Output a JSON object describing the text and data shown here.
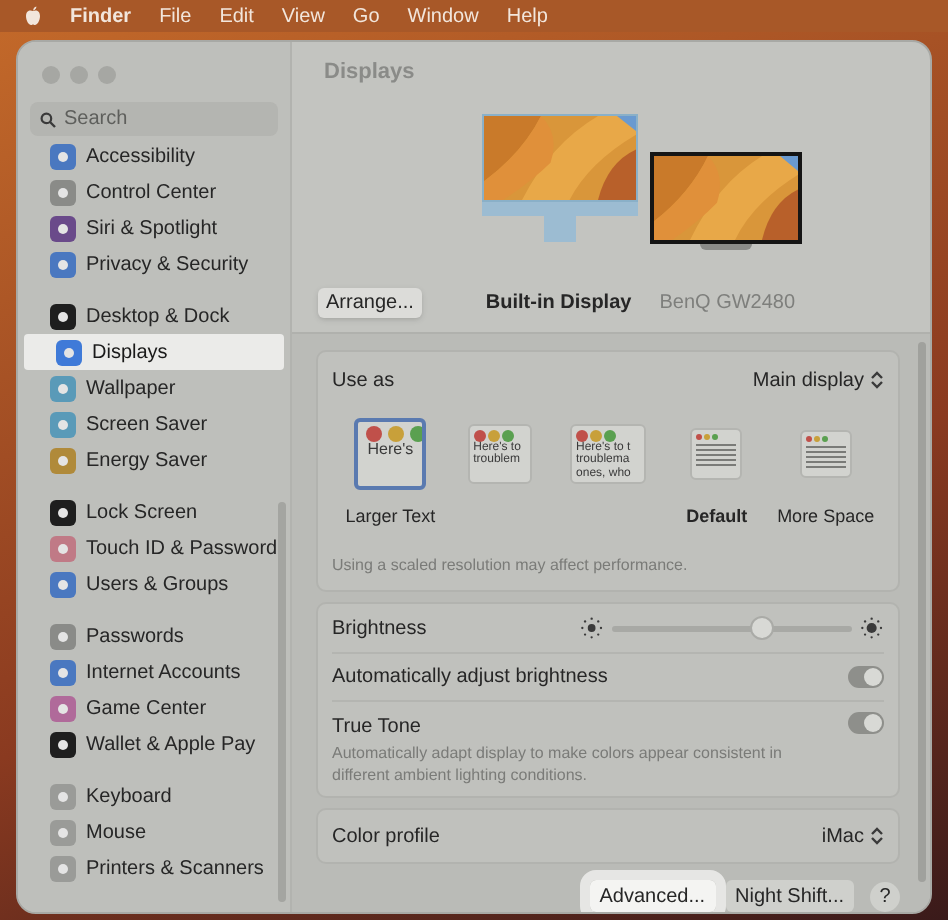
{
  "menu_bar": {
    "app": "Finder",
    "items": [
      "File",
      "Edit",
      "View",
      "Go",
      "Window",
      "Help"
    ]
  },
  "sidebar": {
    "search": {
      "placeholder": "Search"
    },
    "groups": [
      [
        {
          "label": "Accessibility",
          "color": "#4a78c0",
          "selected": false
        },
        {
          "label": "Control Center",
          "color": "#8a8b88",
          "selected": false
        },
        {
          "label": "Siri & Spotlight",
          "color": "#6a4a8a",
          "selected": false
        },
        {
          "label": "Privacy & Security",
          "color": "#4a78c0",
          "selected": false
        }
      ],
      [
        {
          "label": "Desktop & Dock",
          "color": "#1e1e1e",
          "selected": false
        },
        {
          "label": "Displays",
          "color": "#3f7ad8",
          "selected": true
        },
        {
          "label": "Wallpaper",
          "color": "#5a9ab8",
          "selected": false
        },
        {
          "label": "Screen Saver",
          "color": "#5a9ab8",
          "selected": false
        },
        {
          "label": "Energy Saver",
          "color": "#b08a3a",
          "selected": false
        }
      ],
      [
        {
          "label": "Lock Screen",
          "color": "#1e1e1e",
          "selected": false
        },
        {
          "label": "Touch ID & Password",
          "color": "#c07a86",
          "selected": false
        },
        {
          "label": "Users & Groups",
          "color": "#4a78c0",
          "selected": false
        }
      ],
      [
        {
          "label": "Passwords",
          "color": "#8a8b88",
          "selected": false
        },
        {
          "label": "Internet Accounts",
          "color": "#4a78c0",
          "selected": false
        },
        {
          "label": "Game Center",
          "color": "#b06a9a",
          "selected": false
        },
        {
          "label": "Wallet & Apple Pay",
          "color": "#1e1e1e",
          "selected": false
        }
      ],
      [
        {
          "label": "Keyboard",
          "color": "#9a9b98",
          "selected": false
        },
        {
          "label": "Mouse",
          "color": "#9a9b98",
          "selected": false
        },
        {
          "label": "Printers & Scanners",
          "color": "#9a9b98",
          "selected": false
        }
      ]
    ]
  },
  "title": "Displays",
  "arrange_button": "Arrange...",
  "displays": [
    {
      "name": "Built-in Display",
      "kind": "imac",
      "selected": true
    },
    {
      "name": "BenQ GW2480",
      "kind": "monitor",
      "selected": false
    }
  ],
  "use_as": {
    "label": "Use as",
    "value": "Main display"
  },
  "resolutions": [
    {
      "lines": [
        "Here's"
      ],
      "label": "Larger Text",
      "default": false,
      "selected": true
    },
    {
      "lines": [
        "Here's to",
        "troublem"
      ],
      "selected": false
    },
    {
      "lines": [
        "Here's to t",
        "troublema",
        "ones, who"
      ],
      "selected": false
    },
    {
      "label": "Default",
      "default": true,
      "selected": false
    },
    {
      "label": "More Space",
      "default": false,
      "selected": false
    }
  ],
  "resolution_note": "Using a scaled resolution may affect performance.",
  "brightness": {
    "label": "Brightness",
    "level": 0.63
  },
  "auto_brightness": {
    "label": "Automatically adjust brightness",
    "on": true
  },
  "true_tone": {
    "label": "True Tone",
    "description": "Automatically adapt display to make colors appear consistent in different ambient lighting conditions.",
    "on": true
  },
  "color_profile": {
    "label": "Color profile",
    "value": "iMac"
  },
  "buttons": [
    {
      "label": "Advanced...",
      "highlighted": true
    },
    {
      "label": "Night Shift...",
      "highlighted": false
    }
  ],
  "help_button": "?"
}
